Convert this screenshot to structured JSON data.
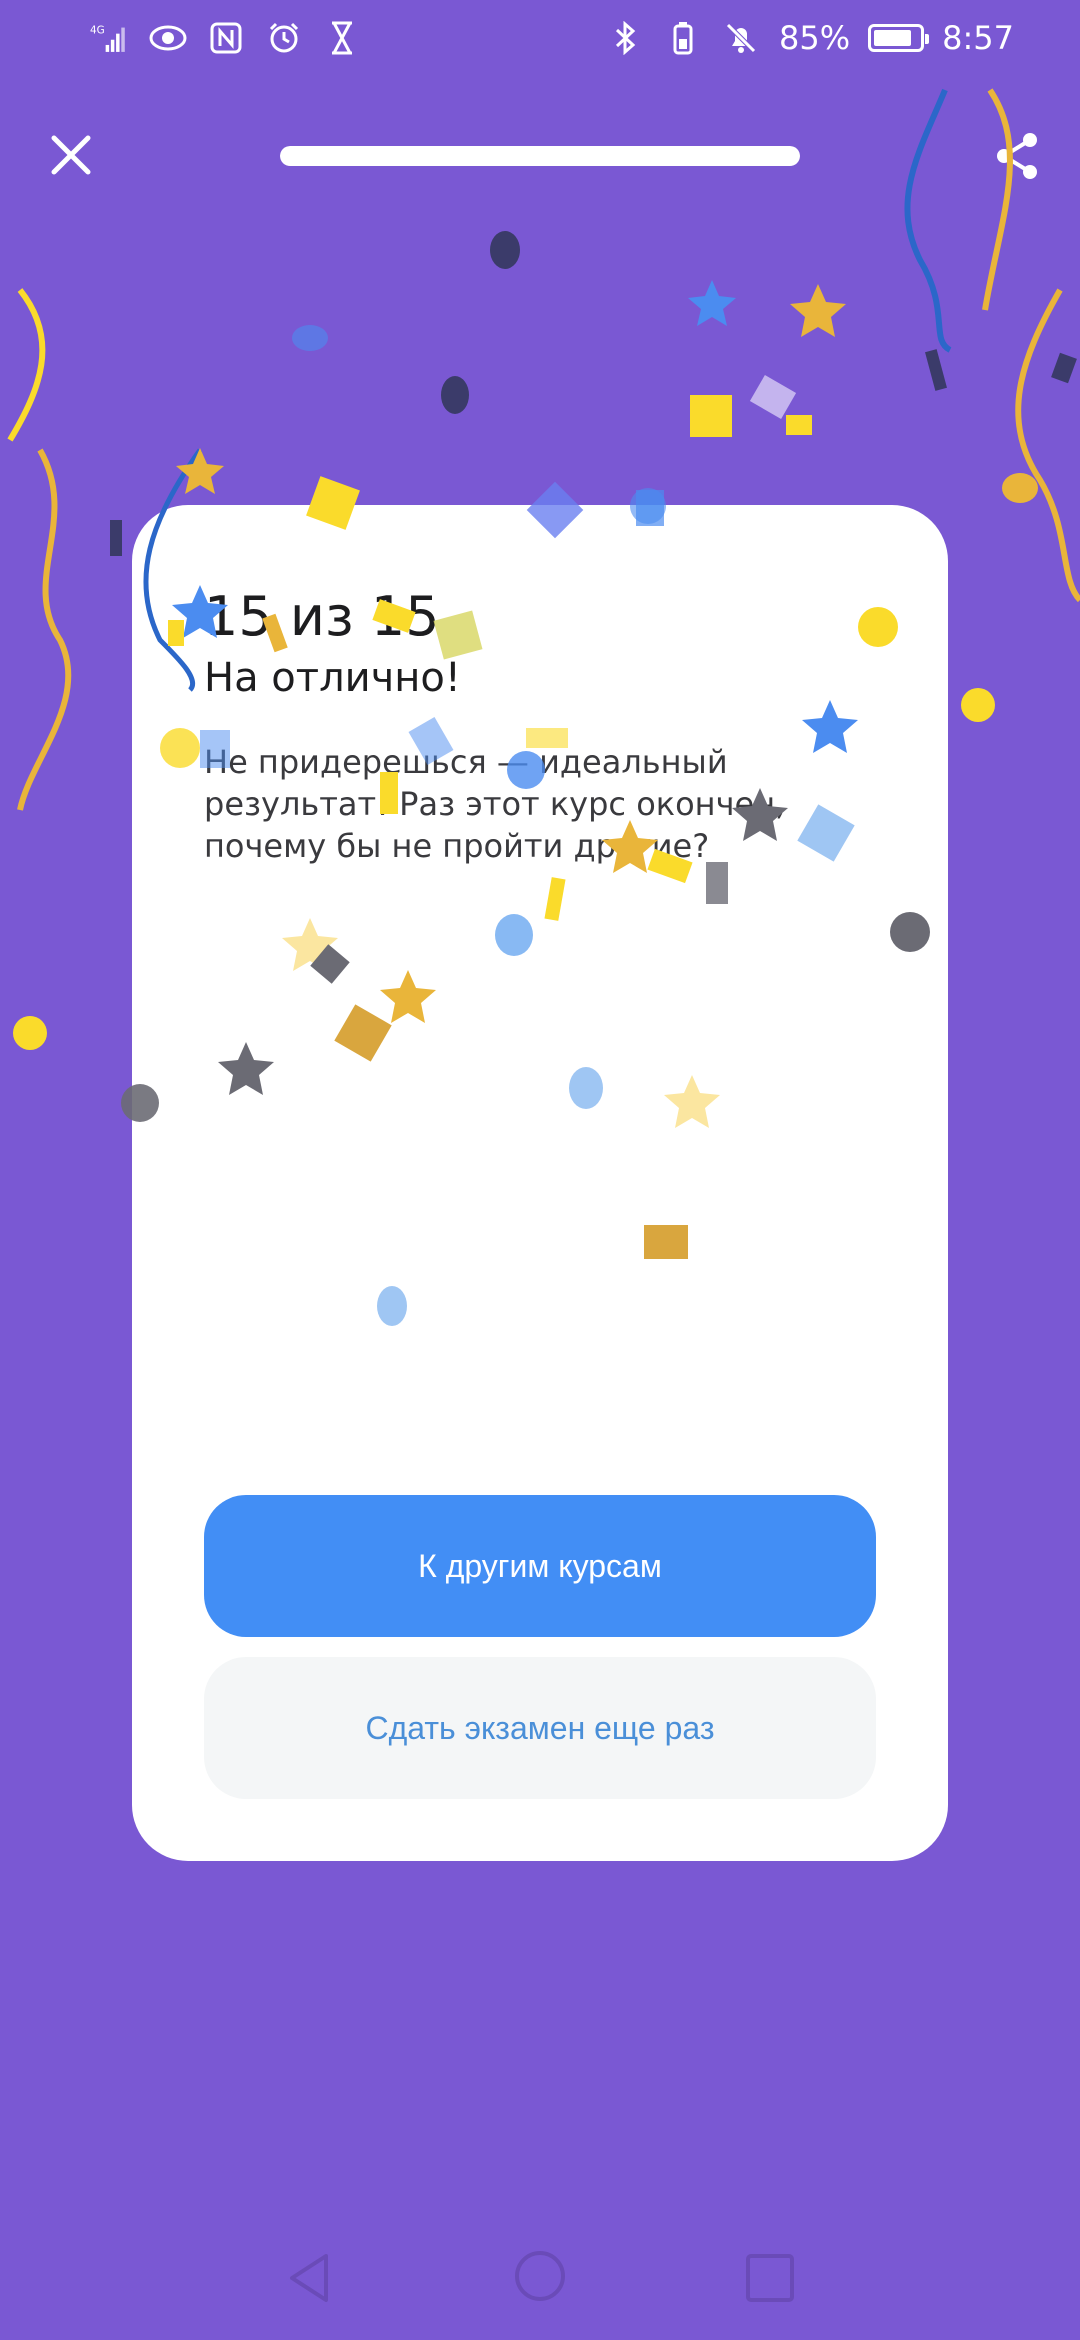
{
  "status_bar": {
    "network": "4G",
    "battery_percent": "85%",
    "battery_level": 0.85,
    "time": "8:57",
    "left_icons": [
      "signal-icon",
      "eye-icon",
      "nfc-icon",
      "alarm-icon",
      "hourglass-icon"
    ],
    "right_icons": [
      "bluetooth-icon",
      "battery-saver-icon",
      "bell-off-icon"
    ]
  },
  "top_bar": {
    "progress_fraction": 1.0
  },
  "result": {
    "score": "15 из 15",
    "headline": "На отлично!",
    "message": "Не придерешься — идеальный результат! Раз этот курс окончен, почему бы не пройти другие?"
  },
  "actions": {
    "primary_label": "К другим курсам",
    "secondary_label": "Сдать экзамен еще раз"
  },
  "colors": {
    "background": "#7a58d3",
    "primary_button": "#428ef5",
    "secondary_text": "#4a8fd8",
    "confetti": [
      "#fadb2b",
      "#e9b53a",
      "#4b8cf0",
      "#9fc6f3",
      "#3b3b6a",
      "#8a8a92"
    ]
  }
}
